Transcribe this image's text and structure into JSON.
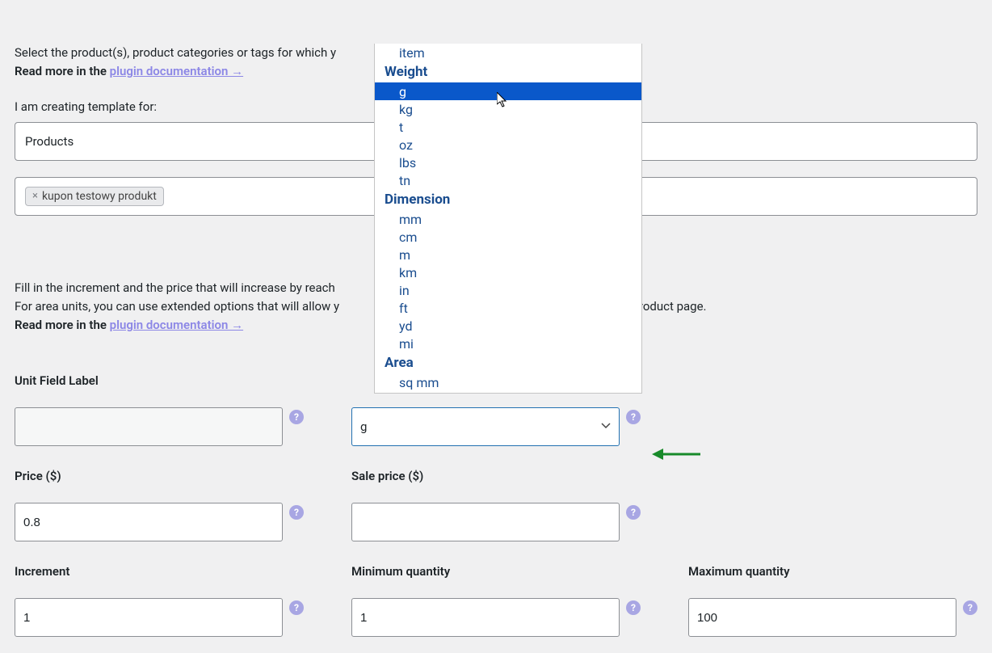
{
  "intro1_part1": "Select the product(s), product categories or tags for which y",
  "intro1_bold": "Read more in the ",
  "intro1_link": "plugin documentation →",
  "template_label": "I am creating template for:",
  "template_value": "Products",
  "tag_value": "kupon testowy produkt",
  "intro2_line1": "Fill in the increment and the price that will increase by reach",
  "intro2_line2_a": "For area units, you can use extended options that will allow y",
  "intro2_line2_b": " the product page.",
  "intro2_bold": "Read more in the ",
  "intro2_link": "plugin documentation →",
  "fields": {
    "unit_label": "Unit Field Label",
    "unit_value": "",
    "select_value": "g",
    "price_label": "Price ($)",
    "price_value": "0.8",
    "sale_label": "Sale price ($)",
    "sale_value": "",
    "increment_label": "Increment",
    "increment_value": "1",
    "min_label": "Minimum quantity",
    "min_value": "1",
    "max_label": "Maximum quantity",
    "max_value": "100"
  },
  "dropdown": {
    "visible_top_item": "item",
    "group_weight": "Weight",
    "weight_opts": [
      "g",
      "kg",
      "t",
      "oz",
      "lbs",
      "tn"
    ],
    "group_dimension": "Dimension",
    "dimension_opts": [
      "mm",
      "cm",
      "m",
      "km",
      "in",
      "ft",
      "yd",
      "mi"
    ],
    "group_area": "Area",
    "area_opts": [
      "sq mm"
    ]
  },
  "help_char": "?",
  "tag_x": "×"
}
